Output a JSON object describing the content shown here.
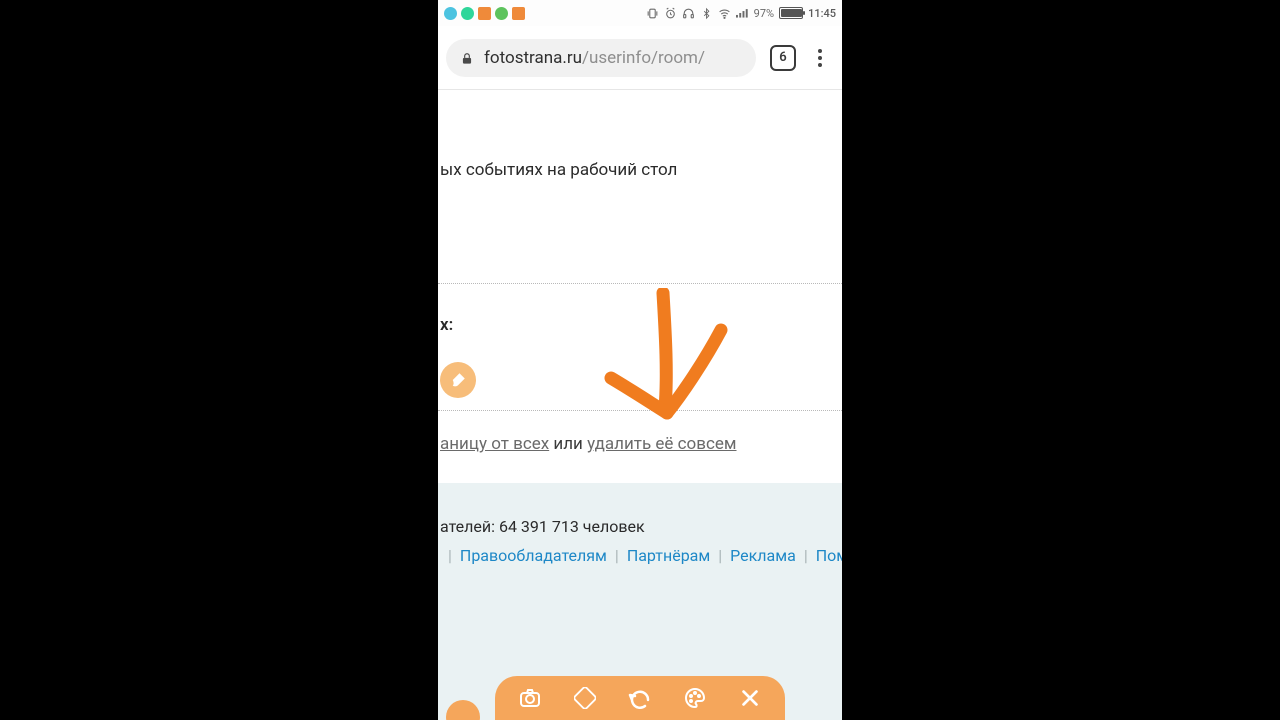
{
  "statusbar": {
    "battery_pct": "97%",
    "clock": "11:45",
    "left_colors": [
      "#4cc3e0",
      "#2fd69a",
      "#ef8a3a",
      "#5dc35d",
      "#ef8a3a"
    ]
  },
  "browser": {
    "url_host": "fotostrana.ru",
    "url_path": "/userinfo/room/",
    "tab_count": "6"
  },
  "page": {
    "text_desktop": "ых событиях на рабочий стол",
    "label_x": "x:",
    "link_hide": "аницу от всех",
    "mid": " или ",
    "link_delete": "удалить её совсем"
  },
  "footer": {
    "count_line": "ателей: 64 391 713 человек",
    "links": [
      "Правообладателям",
      "Партнёрам",
      "Реклама",
      "Пом"
    ]
  },
  "annot_toolbar": {
    "icons": [
      "camera-icon",
      "eraser-icon",
      "undo-icon",
      "palette-icon",
      "close-icon"
    ]
  },
  "arrow_color": "#f07c1f"
}
